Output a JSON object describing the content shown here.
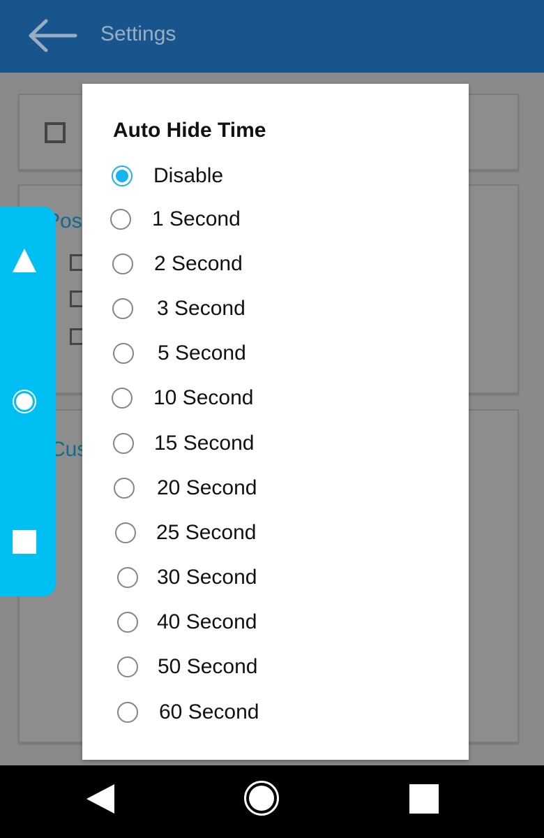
{
  "app_bar": {
    "title": "Settings",
    "back_icon": "arrow-left-icon",
    "color": "#17558c"
  },
  "background_fragments": {
    "card2_label": "Pos",
    "card3_label": "Cus"
  },
  "float_panel": {
    "color": "#00bff2",
    "icons": [
      "triangle-up-icon",
      "circle-icon",
      "square-icon"
    ]
  },
  "dialog": {
    "title": "Auto Hide Time",
    "accent": "#13b4ef",
    "selected_index": 0,
    "options": [
      {
        "label": "Disable",
        "checked": true
      },
      {
        "label": "1 Second",
        "checked": false
      },
      {
        "label": "2 Second",
        "checked": false
      },
      {
        "label": "3 Second",
        "checked": false
      },
      {
        "label": "5 Second",
        "checked": false
      },
      {
        "label": "10 Second",
        "checked": false
      },
      {
        "label": "15 Second",
        "checked": false
      },
      {
        "label": "20 Second",
        "checked": false
      },
      {
        "label": "25 Second",
        "checked": false
      },
      {
        "label": "30 Second",
        "checked": false
      },
      {
        "label": "40 Second",
        "checked": false
      },
      {
        "label": "50 Second",
        "checked": false
      },
      {
        "label": "60 Second",
        "checked": false
      }
    ]
  },
  "nav_bar": {
    "icons": [
      "back-triangle-icon",
      "home-circle-icon",
      "recents-square-icon"
    ]
  }
}
